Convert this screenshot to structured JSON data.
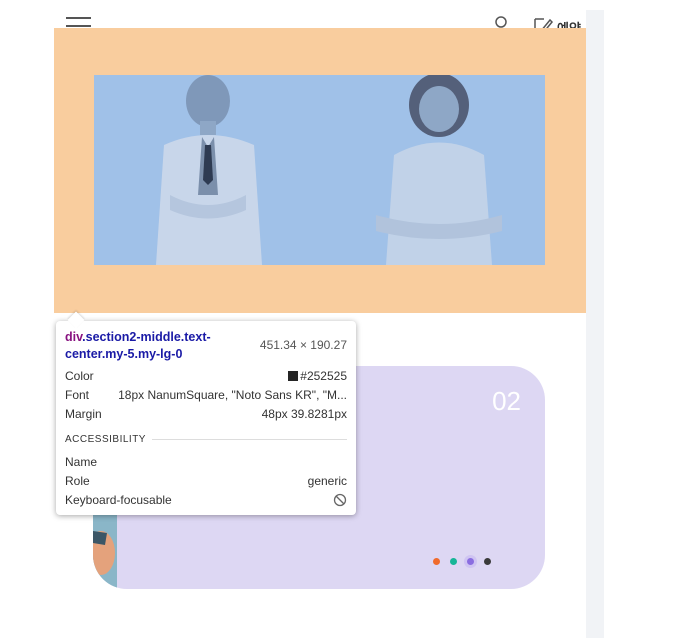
{
  "header": {
    "menu_icon": "hamburger-icon",
    "user_icon": "user-icon",
    "reserve_icon": "edit-document-icon",
    "reserve_label": "예약"
  },
  "hero": {
    "background_color": "#f9cd9e",
    "photo_bg_color": "#a0c1e8"
  },
  "card": {
    "number": "02",
    "background_color": "#ddd7f3",
    "dots": [
      {
        "color": "#f06a2c",
        "active": false
      },
      {
        "color": "#16b597",
        "active": false
      },
      {
        "color": "#8a6de0",
        "active": true
      },
      {
        "color": "#3a3a3a",
        "active": false
      }
    ]
  },
  "inspector": {
    "tag": "div",
    "classes": ".section2-middle.text-center.my-5.my-lg-0",
    "dimensions": "451.34 × 190.27",
    "rows": [
      {
        "label": "Color",
        "value": "#252525"
      },
      {
        "label": "Font",
        "value": "18px NanumSquare, \"Noto Sans KR\", \"M..."
      },
      {
        "label": "Margin",
        "value": "48px 39.8281px"
      }
    ],
    "accessibility_heading": "ACCESSIBILITY",
    "a11y_rows": [
      {
        "label": "Name",
        "value": ""
      },
      {
        "label": "Role",
        "value": "generic"
      },
      {
        "label": "Keyboard-focusable",
        "value": ""
      }
    ],
    "not_focusable_icon": "prohibited-icon"
  }
}
